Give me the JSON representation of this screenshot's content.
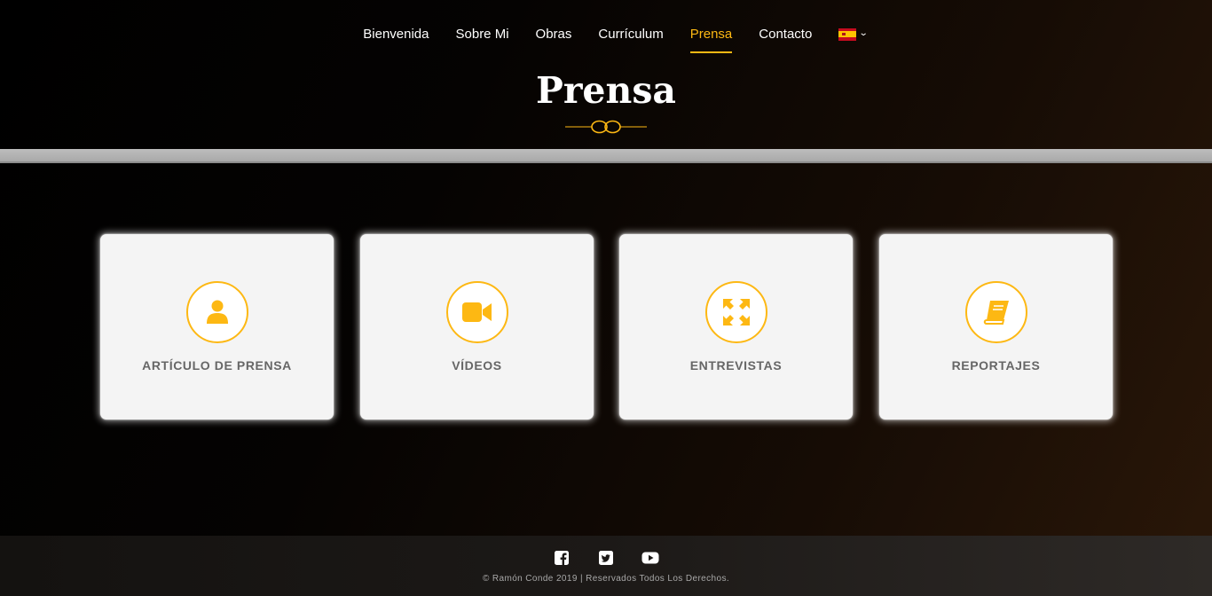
{
  "nav": {
    "items": [
      {
        "label": "Bienvenida"
      },
      {
        "label": "Sobre Mi"
      },
      {
        "label": "Obras"
      },
      {
        "label": "Currículum"
      },
      {
        "label": "Prensa",
        "active": true
      },
      {
        "label": "Contacto"
      }
    ],
    "language": {
      "icon": "spain-flag-icon",
      "dropdown_icon": "chevron-down-icon"
    }
  },
  "page": {
    "title": "Prensa",
    "ornament_icon": "infinity-ornament-icon"
  },
  "cards": [
    {
      "label": "ARTÍCULO DE PRENSA",
      "icon": "user-icon"
    },
    {
      "label": "VÍDEOS",
      "icon": "video-camera-icon"
    },
    {
      "label": "ENTREVISTAS",
      "icon": "expand-arrows-icon"
    },
    {
      "label": "REPORTAJES",
      "icon": "book-icon"
    }
  ],
  "footer": {
    "social": [
      "facebook-icon",
      "twitter-icon",
      "youtube-icon"
    ],
    "copyright": "© Ramón Conde 2019 | Reservados Todos Los Derechos."
  },
  "colors": {
    "accent": "#fdb813",
    "card_bg": "#f4f4f4",
    "card_text": "#666666",
    "band": "#b0b0b0"
  }
}
